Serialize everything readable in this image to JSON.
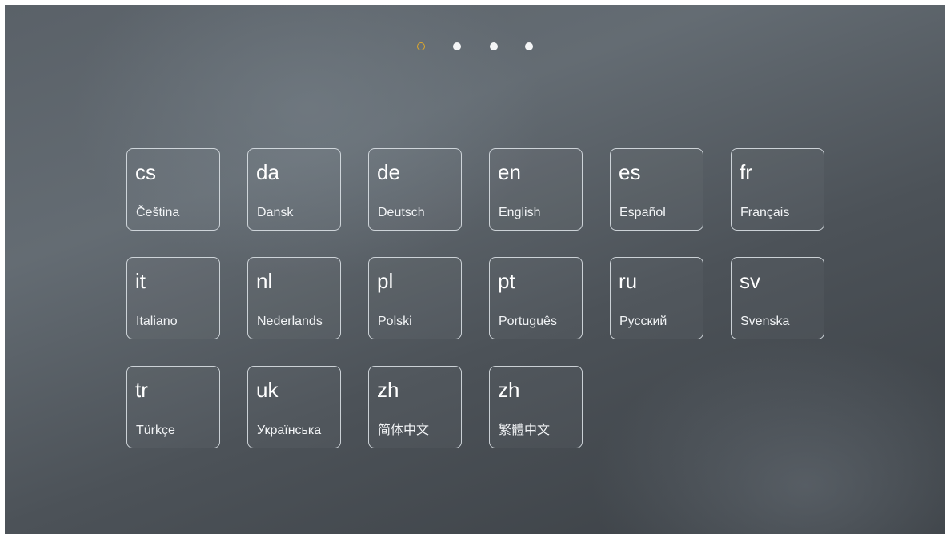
{
  "pager": {
    "pages": [
      {
        "state": "active"
      },
      {
        "state": "inactive"
      },
      {
        "state": "inactive"
      },
      {
        "state": "inactive"
      }
    ],
    "active_color": "#e0a92a",
    "inactive_color": "#f4f5f6"
  },
  "languages": [
    {
      "code": "cs",
      "name": "Čeština"
    },
    {
      "code": "da",
      "name": "Dansk"
    },
    {
      "code": "de",
      "name": "Deutsch"
    },
    {
      "code": "en",
      "name": "English"
    },
    {
      "code": "es",
      "name": "Español"
    },
    {
      "code": "fr",
      "name": "Français"
    },
    {
      "code": "it",
      "name": "Italiano"
    },
    {
      "code": "nl",
      "name": "Nederlands"
    },
    {
      "code": "pl",
      "name": "Polski"
    },
    {
      "code": "pt",
      "name": "Português"
    },
    {
      "code": "ru",
      "name": "Русский"
    },
    {
      "code": "sv",
      "name": "Svenska"
    },
    {
      "code": "tr",
      "name": "Türkçe"
    },
    {
      "code": "uk",
      "name": "Українська"
    },
    {
      "code": "zh",
      "name": "简体中文"
    },
    {
      "code": "zh",
      "name": "繁體中文"
    }
  ]
}
